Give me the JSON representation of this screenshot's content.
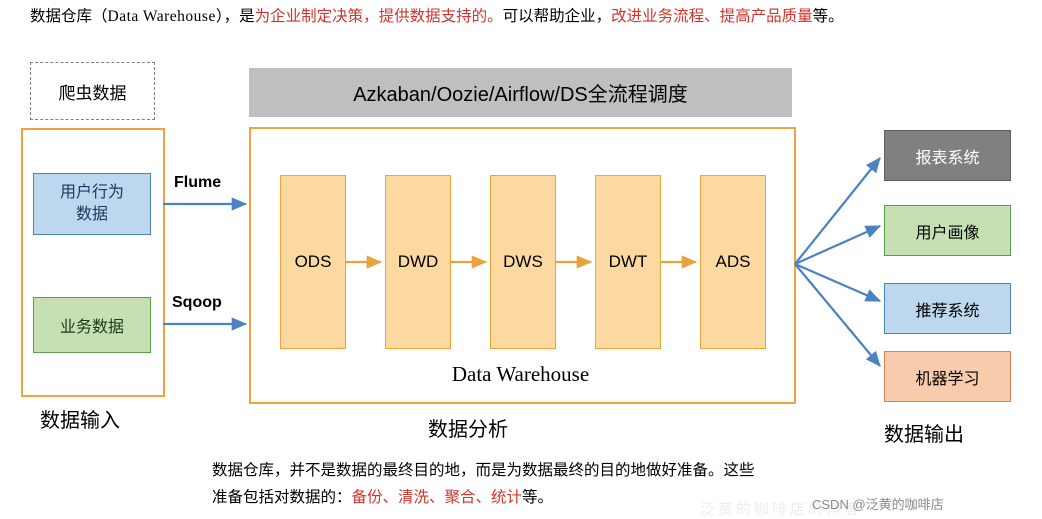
{
  "top_caption": {
    "seg1": "数据仓库（",
    "seg2": "Data Warehouse",
    "seg3": "），是",
    "seg4_red": "为企业制定决策，提供数据支持的。",
    "seg5": "可以帮助企业，",
    "seg6_red": "改进业务流程、提高产品质量",
    "seg7": "等。"
  },
  "input_section": {
    "crawler_label": "爬虫数据",
    "user_behavior_line1": "用户行为",
    "user_behavior_line2": "数据",
    "business_data_label": "业务数据",
    "group_label": "数据输入",
    "arrow_flume": "Flume",
    "arrow_sqoop": "Sqoop"
  },
  "scheduler": {
    "label": "Azkaban/Oozie/Airflow/DS全流程调度"
  },
  "warehouse": {
    "title": "Data Warehouse",
    "group_label": "数据分析",
    "stages": [
      "ODS",
      "DWD",
      "DWS",
      "DWT",
      "ADS"
    ]
  },
  "output_section": {
    "group_label": "数据输出",
    "items": [
      {
        "label": "报表系统",
        "color": "#808080"
      },
      {
        "label": "用户画像",
        "color": "#c6e0b4"
      },
      {
        "label": "推荐系统",
        "color": "#bdd7ee"
      },
      {
        "label": "机器学习",
        "color": "#f8cbad"
      }
    ]
  },
  "bottom_caption": {
    "line1": "数据仓库，并不是数据的最终目的地，而是为数据最终的目的地做好准备。这些",
    "line2_a": "准备包括对数据的：",
    "line2_red": "备份、清洗、聚合、统计",
    "line2_b": "等。"
  },
  "watermark": {
    "text": "CSDN @泛黄的咖啡店",
    "faint": "泛黄的咖啡店的博客"
  },
  "colors": {
    "orange_border": "#f0a33a",
    "stage_fill": "#fcd9a0",
    "blue_fill": "#bdd7ee",
    "green_fill": "#c6e0b4",
    "gray_fill": "#bfbfbf",
    "arrow_blue": "#4a82c4",
    "red_text": "#d0342c"
  }
}
